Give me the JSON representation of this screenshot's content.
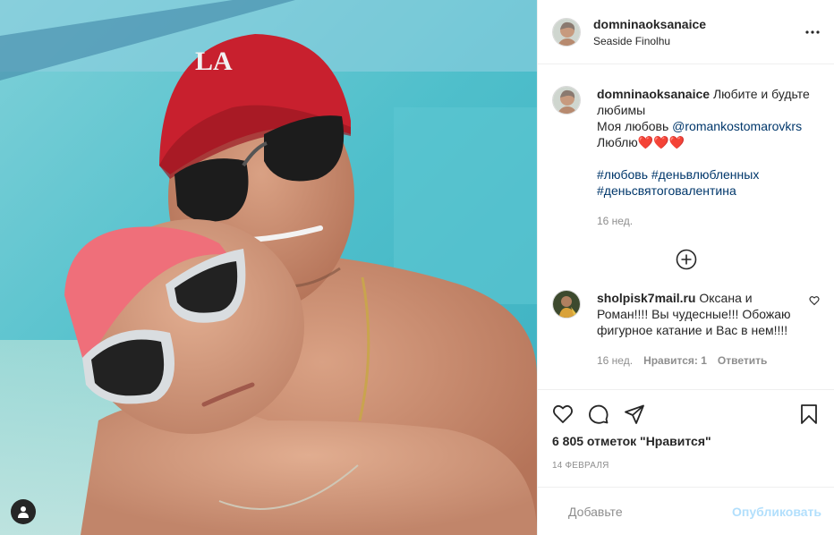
{
  "post": {
    "username": "domninaoksanaice",
    "location": "Seaside Finolhu",
    "more_icon": "more-horizontal-icon"
  },
  "caption": {
    "username": "domninaoksanaice",
    "line1": "Любите и будьте любимы",
    "line2_prefix": "Моя любовь ",
    "mention": "@romankostomarovkrs",
    "line3": "Люблю❤️❤️❤️",
    "hashtags": [
      "#любовь",
      "#деньвлюбленных",
      "#деньсвятоговалентина"
    ],
    "time": "16 нед."
  },
  "load_more_icon": "plus-circle-icon",
  "comments": [
    {
      "username": "sholpisk7mail.ru",
      "text": "Оксана и Роман!!!! Вы чудесные!!! Обожаю фигурное катание и Вас в нем!!!!",
      "time": "16 нед.",
      "likes": "Нравится: 1",
      "reply": "Ответить"
    }
  ],
  "actions": {
    "like_icon": "heart-icon",
    "comment_icon": "comment-icon",
    "share_icon": "send-icon",
    "save_icon": "bookmark-icon"
  },
  "likes": "6 805 отметок \"Нравится\"",
  "date": "14 ФЕВРАЛЯ",
  "add_comment": {
    "emoji_icon": "emoji-icon",
    "placeholder": "Добавьте",
    "submit": "Опубликовать"
  },
  "colors": {
    "text": "#262626",
    "secondary": "#8e8e8e",
    "link": "#00376b",
    "publish_disabled": "#b2dffc",
    "border": "#efefef"
  }
}
